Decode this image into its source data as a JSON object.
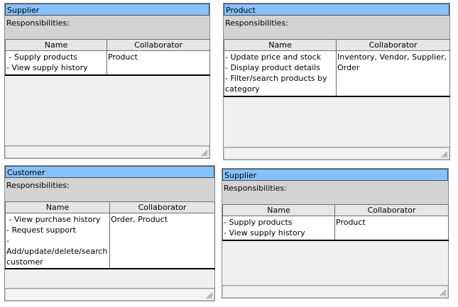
{
  "cards": [
    {
      "title": "Supplier",
      "responsibilities_label": "Responsibilities:",
      "name_header": "Name",
      "collaborator_header": "Collaborator",
      "names": [
        " - Supply products",
        "- View supply history"
      ],
      "collaborators": [
        "Product"
      ]
    },
    {
      "title": "Product",
      "responsibilities_label": "Responsibilities:",
      "name_header": "Name",
      "collaborator_header": "Collaborator",
      "names": [
        "- Update price and stock",
        "- Display product details",
        "- Filter/search products by category"
      ],
      "collaborators": [
        "Inventory, Vendor, Supplier, Order"
      ]
    },
    {
      "title": "Customer",
      "responsibilities_label": "Responsibilities:",
      "name_header": "Name",
      "collaborator_header": "Collaborator",
      "names": [
        " - View purchase history",
        "- Request support",
        "- Add/update/delete/search customer"
      ],
      "collaborators": [
        "Order, Product"
      ]
    },
    {
      "title": "Supplier",
      "responsibilities_label": "Responsibilities:",
      "name_header": "Name",
      "collaborator_header": "Collaborator",
      "names": [
        "- Supply products",
        "- View supply history"
      ],
      "collaborators": [
        "Product"
      ]
    }
  ]
}
